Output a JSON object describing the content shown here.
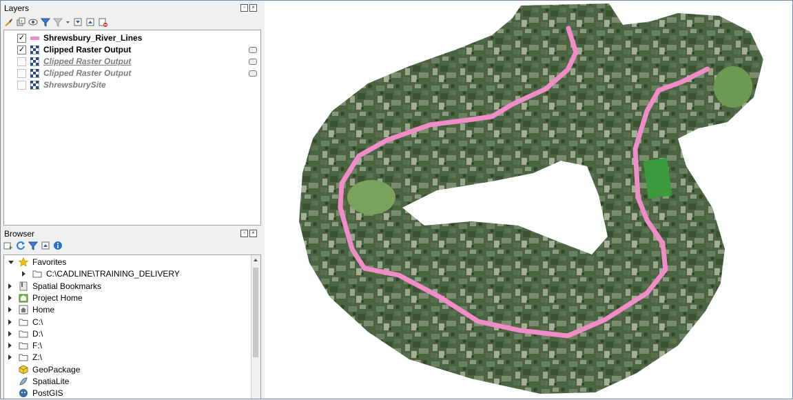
{
  "layers_panel": {
    "title": "Layers",
    "items": [
      {
        "name": "Shrewsbury_River_Lines",
        "checked": true,
        "style": "normal",
        "symbol": "line"
      },
      {
        "name": "Clipped Raster Output",
        "checked": true,
        "style": "normal",
        "symbol": "raster"
      },
      {
        "name": "Clipped Raster Output",
        "checked": false,
        "style": "disabled-underline",
        "symbol": "raster"
      },
      {
        "name": "Clipped Raster Output",
        "checked": false,
        "style": "disabled",
        "symbol": "raster"
      },
      {
        "name": "ShrewsburySite",
        "checked": false,
        "style": "disabled",
        "symbol": "raster"
      }
    ]
  },
  "browser_panel": {
    "title": "Browser",
    "items": [
      {
        "label": "Favorites",
        "icon": "star-icon",
        "expanded": true
      },
      {
        "label": "C:\\CADLINE\\TRAINING_DELIVERY",
        "icon": "folder-icon",
        "expanded": false
      },
      {
        "label": "Spatial Bookmarks",
        "icon": "bookmarks-icon",
        "expanded": false
      },
      {
        "label": "Project Home",
        "icon": "project-home-icon",
        "expanded": false
      },
      {
        "label": "Home",
        "icon": "home-icon",
        "expanded": false
      },
      {
        "label": "C:\\",
        "icon": "folder-icon",
        "expanded": false
      },
      {
        "label": "D:\\",
        "icon": "folder-icon",
        "expanded": false
      },
      {
        "label": "F:\\",
        "icon": "folder-icon",
        "expanded": false
      },
      {
        "label": "Z:\\",
        "icon": "folder-icon",
        "expanded": false
      },
      {
        "label": "GeoPackage",
        "icon": "geopackage-icon",
        "expanded": false
      },
      {
        "label": "SpatiaLite",
        "icon": "spatialite-icon",
        "expanded": false
      },
      {
        "label": "PostGIS",
        "icon": "postgis-icon",
        "expanded": false
      }
    ]
  },
  "colors": {
    "river_line": "#f08cc8",
    "imagery_dark": "#3f5a38",
    "imagery_mid": "#5f7a55",
    "imagery_light": "#8fa07a",
    "star": "#f2c200"
  }
}
